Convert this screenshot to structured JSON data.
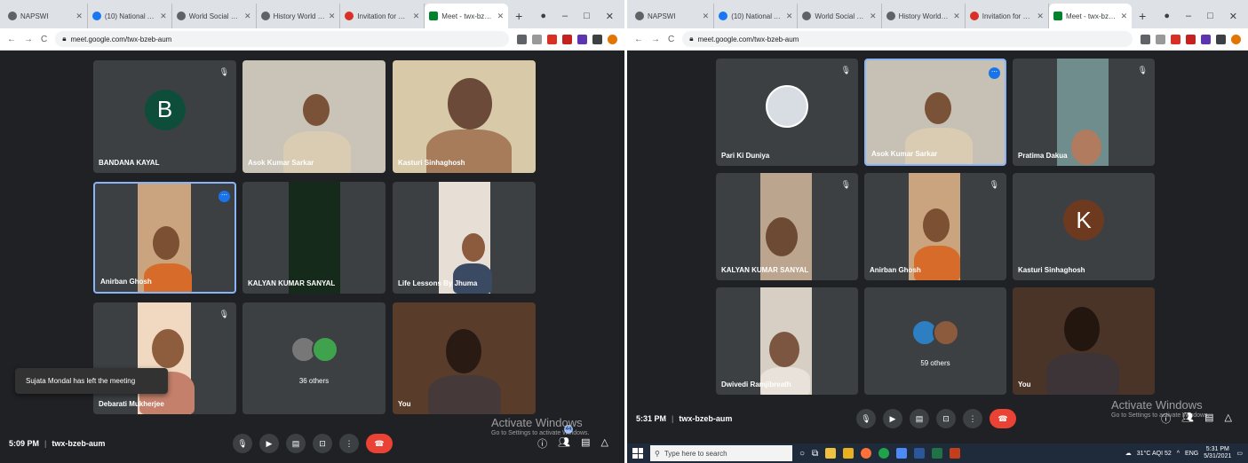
{
  "left": {
    "tabs": [
      {
        "icon": "github-icon",
        "title": "NAPSWI"
      },
      {
        "icon": "facebook-icon",
        "title": "(10) National Associa"
      },
      {
        "icon": "page-icon",
        "title": "World Social Work Da"
      },
      {
        "icon": "page-icon",
        "title": "History World Social"
      },
      {
        "icon": "kotak-icon",
        "title": "Invitation for Social W"
      },
      {
        "icon": "meet-icon",
        "title": "Meet - twx-bzeb-"
      }
    ],
    "url": "meet.google.com/twx-bzeb-aum",
    "tiles": [
      {
        "name": "BANDANA KAYAL",
        "initial": "B",
        "color": "#0f4d3b"
      },
      {
        "name": "Asok Kumar Sarkar"
      },
      {
        "name": "Kasturi Sinhaghosh"
      },
      {
        "name": "Anirban Ghosh"
      },
      {
        "name": "KALYAN KUMAR SANYAL"
      },
      {
        "name": "Life Lessons By Jhuma"
      },
      {
        "name": "Debarati Mukherjee"
      },
      {
        "others": "36 others"
      },
      {
        "name": "You"
      }
    ],
    "toast": "Sujata Mondal has left the meeting",
    "time": "5:09 PM",
    "code": "twx-bzeb-aum",
    "people_count": "44"
  },
  "right": {
    "tabs": [
      {
        "icon": "github-icon",
        "title": "NAPSWI"
      },
      {
        "icon": "facebook-icon",
        "title": "(10) National Associa"
      },
      {
        "icon": "page-icon",
        "title": "World Social Work Da"
      },
      {
        "icon": "page-icon",
        "title": "History World Social W"
      },
      {
        "icon": "kotak-icon",
        "title": "Invitation for Social W"
      },
      {
        "icon": "meet-icon",
        "title": "Meet - twx-bzeb-"
      }
    ],
    "url": "meet.google.com/twx-bzeb-aum",
    "tiles": [
      {
        "name": "Pari Ki Duniya"
      },
      {
        "name": "Asok Kumar Sarkar"
      },
      {
        "name": "Pratima Dakua"
      },
      {
        "name": "KALYAN KUMAR SANYAL"
      },
      {
        "name": "Anirban Ghosh"
      },
      {
        "name": "Kasturi Sinhaghosh",
        "initial": "K",
        "color": "#6d3a1f"
      },
      {
        "name": "Dwivedi Ramjibreath"
      },
      {
        "others": "59 others"
      },
      {
        "name": "You"
      }
    ],
    "time": "5:31 PM",
    "code": "twx-bzeb-aum",
    "taskbar": {
      "search": "Type here to search",
      "weather": "31°C AQI 52",
      "lang": "ENG",
      "clock_time": "5:31 PM",
      "clock_date": "5/31/2021"
    }
  },
  "watermark": {
    "title": "Activate Windows",
    "sub": "Go to Settings to activate Windows."
  }
}
